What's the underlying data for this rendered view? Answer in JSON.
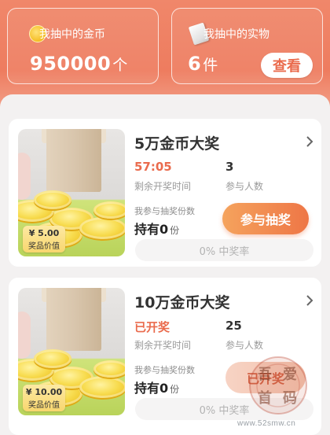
{
  "stats": {
    "coins": {
      "label": "我抽中的金币",
      "value": "950000",
      "unit": "个",
      "icon": "coin-icon"
    },
    "items": {
      "label": "我抽中的实物",
      "value": "6",
      "unit": "件",
      "icon": "gift-box-icon",
      "button": "查看"
    }
  },
  "prizes": [
    {
      "title": "5万金币大奖",
      "time_value": "57:05",
      "time_label": "剩余开奖时间",
      "participants_value": "3",
      "participants_label": "参与人数",
      "share_label": "我参与抽奖份数",
      "hold_label": "持有",
      "hold_value": "0",
      "hold_unit": "份",
      "button": "参与抽奖",
      "price": "¥ 5.00",
      "price_label": "奖品价值",
      "rate": "0% 中奖率"
    },
    {
      "title": "10万金币大奖",
      "time_value": "已开奖",
      "time_label": "剩余开奖时间",
      "participants_value": "25",
      "participants_label": "参与人数",
      "share_label": "我参与抽奖份数",
      "hold_label": "持有",
      "hold_value": "0",
      "hold_unit": "份",
      "button": "已开奖",
      "price": "¥ 10.00",
      "price_label": "奖品价值",
      "rate": "0% 中奖率"
    }
  ],
  "watermark": {
    "text": "www.52smw.cn",
    "seal": "吾爱首码"
  },
  "colors": {
    "accent": "#ee7c5f",
    "countdown": "#ea6b4d",
    "button_gradient_end": "#ee7646"
  }
}
